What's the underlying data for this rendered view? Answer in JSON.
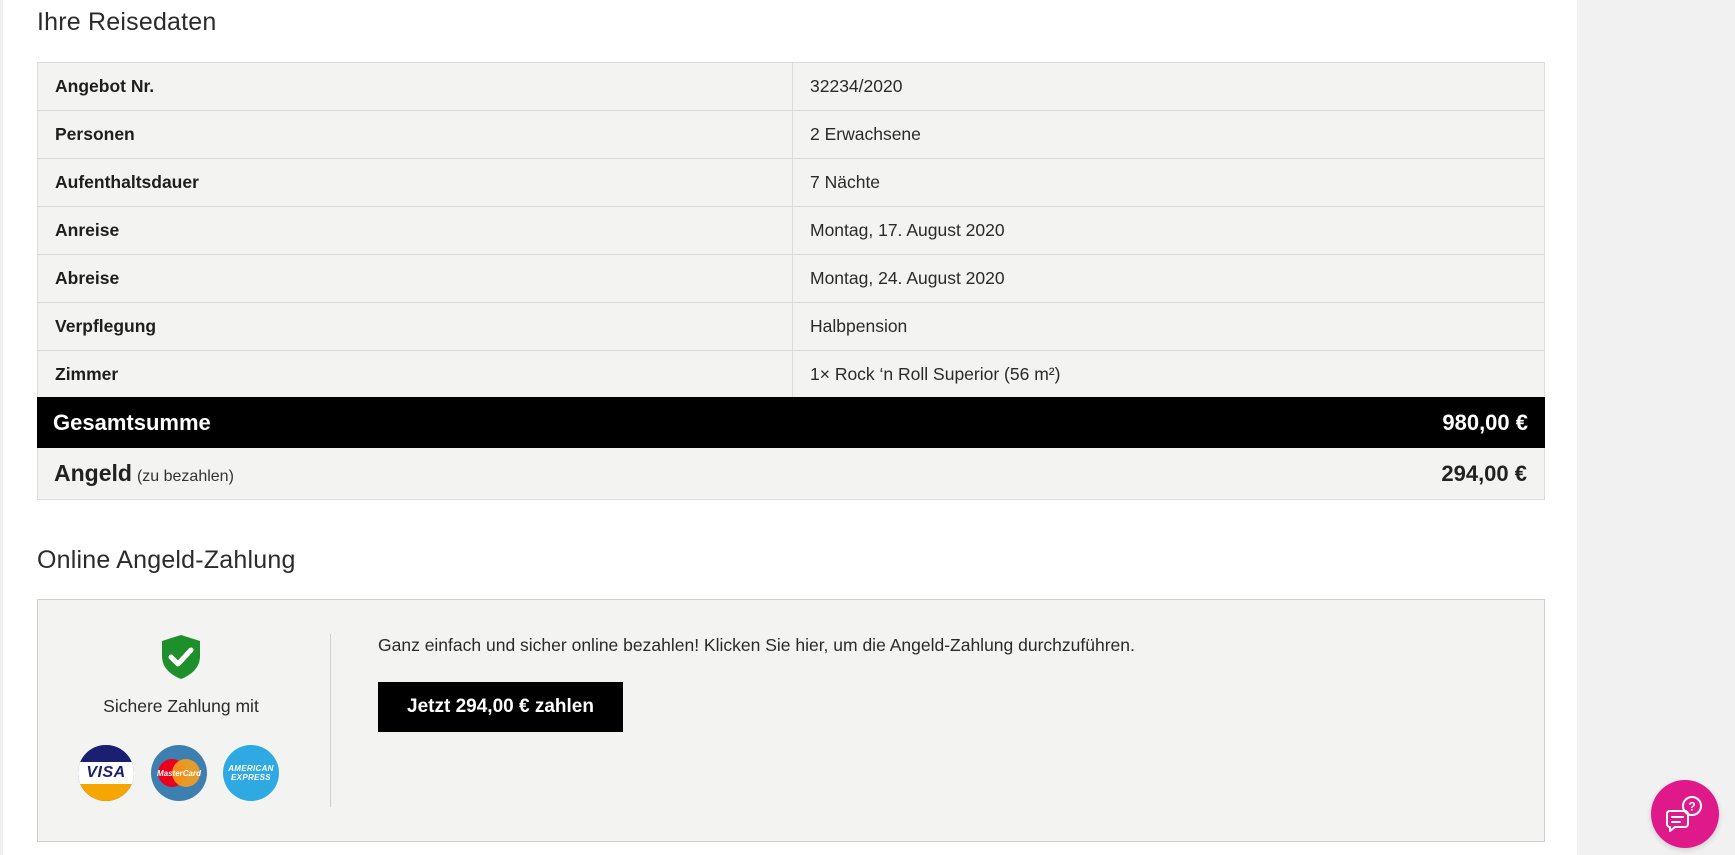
{
  "sections": {
    "travel_title": "Ihre Reisedaten",
    "online_title": "Online Angeld-Zahlung"
  },
  "travel_rows": [
    {
      "label": "Angebot Nr.",
      "value": "32234/2020"
    },
    {
      "label": "Personen",
      "value": "2 Erwachsene"
    },
    {
      "label": "Aufenthaltsdauer",
      "value": "7 Nächte"
    },
    {
      "label": "Anreise",
      "value": "Montag, 17. August 2020"
    },
    {
      "label": "Abreise",
      "value": "Montag, 24. August 2020"
    },
    {
      "label": "Verpflegung",
      "value": "Halbpension"
    },
    {
      "label": "Zimmer",
      "value": "1× Rock ‘n Roll Superior (56 m²)"
    }
  ],
  "total": {
    "label": "Gesamtsumme",
    "amount": "980,00 €"
  },
  "deposit": {
    "label": "Angeld",
    "note": "(zu bezahlen)",
    "amount": "294,00 €"
  },
  "payment": {
    "secure_text": "Sichere Zahlung mit",
    "description": "Ganz einfach und sicher online bezahlen! Klicken Sie hier, um die Angeld-Zahlung durchzuführen.",
    "button_label": "Jetzt 294,00 € zahlen",
    "cards": [
      {
        "name": "VISA",
        "icon": "visa-card-icon"
      },
      {
        "name": "MasterCard",
        "icon": "mastercard-icon"
      },
      {
        "name": "AMERICAN EXPRESS",
        "icon": "amex-card-icon"
      }
    ]
  },
  "colors": {
    "accent_help": "#e0198a",
    "shield_green": "#1e8f2a",
    "row_bg": "#f3f3f2",
    "total_bg": "#000000"
  },
  "icons": {
    "shield": "shield-check-icon",
    "help": "chat-help-icon"
  }
}
